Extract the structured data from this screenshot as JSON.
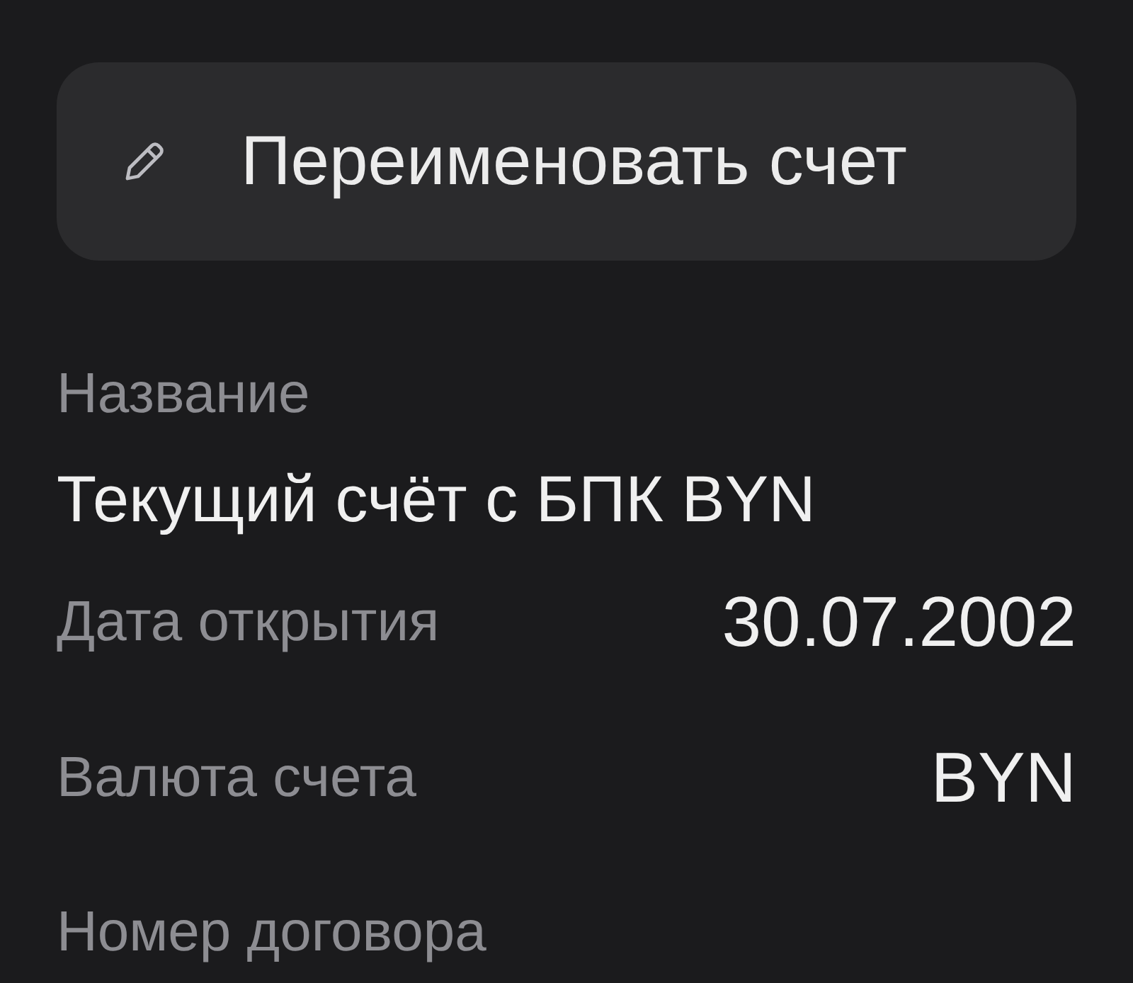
{
  "rename_button": {
    "label": "Переименовать счет"
  },
  "name_field": {
    "label": "Название",
    "value": "Текущий счёт с БПК BYN"
  },
  "details": [
    {
      "label": "Дата открытия",
      "value": "30.07.2002"
    },
    {
      "label": "Валюта счета",
      "value": "BYN"
    }
  ],
  "next_field": {
    "label": "Номер договора"
  }
}
